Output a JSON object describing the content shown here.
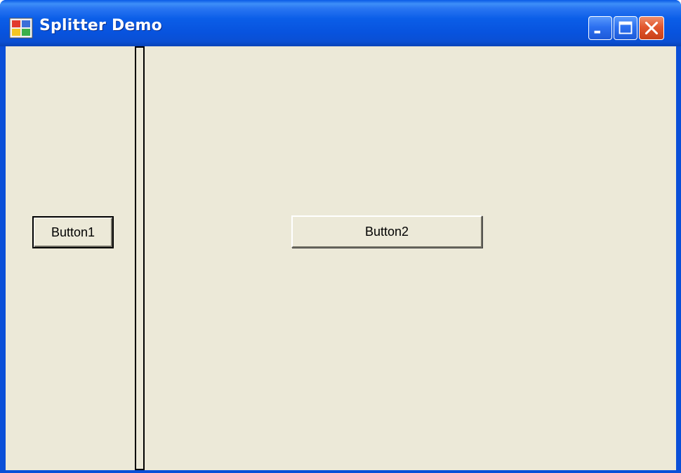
{
  "window": {
    "title": "Splitter Demo",
    "icon": "app-window-icon",
    "controls": {
      "minimize_icon": "minimize-icon",
      "maximize_icon": "maximize-icon",
      "close_icon": "close-icon"
    }
  },
  "left_panel": {
    "button_label": "Button1"
  },
  "right_panel": {
    "button_label": "Button2"
  },
  "colors": {
    "titlebar_blue": "#0a5ae6",
    "client_background": "#ece9d8",
    "close_button": "#e2572e"
  }
}
